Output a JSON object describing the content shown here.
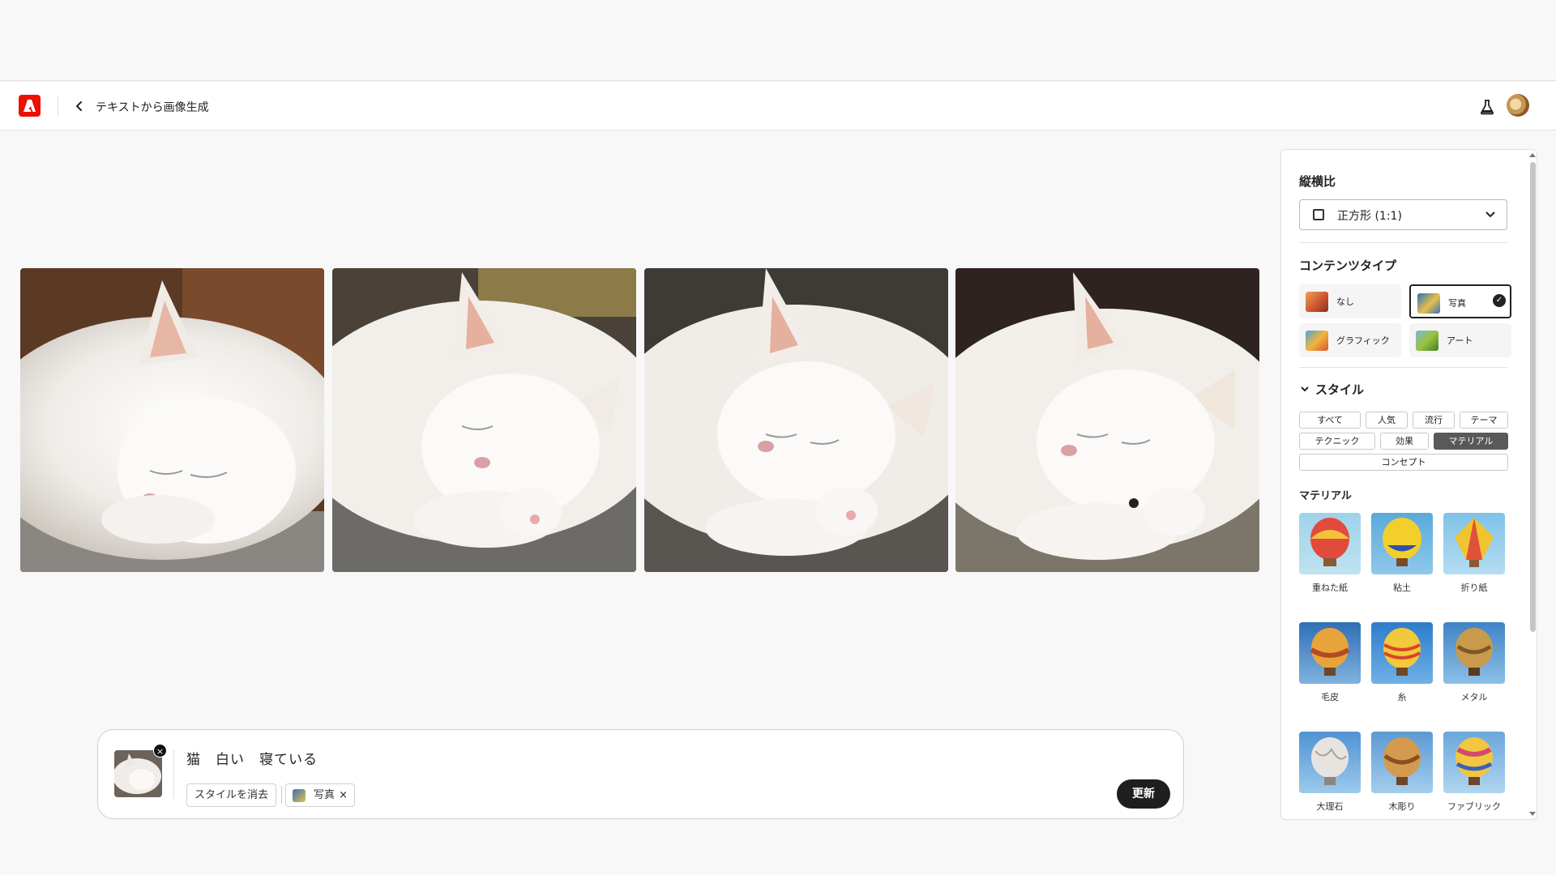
{
  "header": {
    "back_label": "‹",
    "title": "テキストから画像生成",
    "logo_icon": "adobe-logo-icon",
    "labs_icon": "beaker-icon",
    "avatar": "user-avatar"
  },
  "gallery": {
    "images": [
      {
        "alt": "sleeping-white-cat-1"
      },
      {
        "alt": "sleeping-white-cat-2"
      },
      {
        "alt": "sleeping-white-cat-3"
      },
      {
        "alt": "sleeping-white-cat-4"
      }
    ]
  },
  "prompt": {
    "text": "猫　白い　寝ている",
    "clear_style_label": "スタイルを消去",
    "photo_chip_label": "写真",
    "photo_chip_remove": "×",
    "thumb_remove": "×",
    "update_label": "更新"
  },
  "panel": {
    "aspect_title": "縦横比",
    "aspect_value": "正方形 (1:1)",
    "content_type_title": "コンテンツタイプ",
    "content_types": [
      {
        "label": "なし",
        "selected": false
      },
      {
        "label": "写真",
        "selected": true
      },
      {
        "label": "グラフィック",
        "selected": false
      },
      {
        "label": "アート",
        "selected": false
      }
    ],
    "style_title": "スタイル",
    "style_tabs": [
      "すべて",
      "人気",
      "流行",
      "テーマ",
      "テクニック",
      "効果",
      "マテリアル",
      "コンセプト"
    ],
    "active_style_tab": "マテリアル",
    "material_title": "マテリアル",
    "materials": [
      "重ねた紙",
      "粘土",
      "折り紙",
      "毛皮",
      "糸",
      "メタル",
      "大理石",
      "木彫り",
      "ファブリック"
    ],
    "check_mark": "✓"
  },
  "colors": {
    "brand": "#eb1000",
    "button_dark": "#1e1e1e",
    "active_tag": "#595959"
  }
}
